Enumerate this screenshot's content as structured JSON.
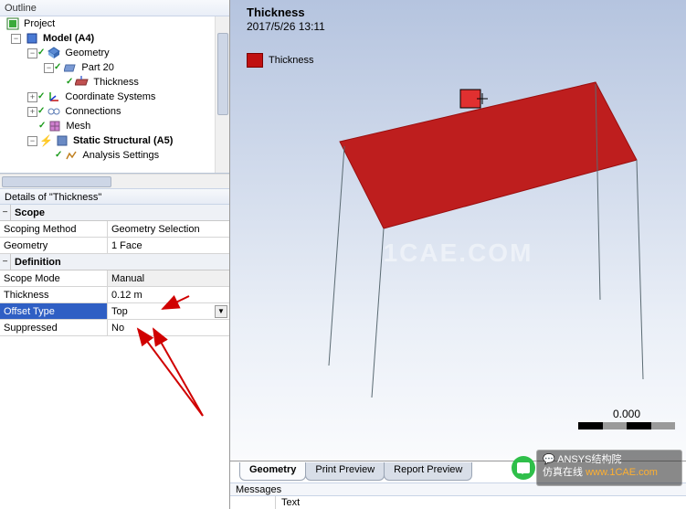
{
  "outline": {
    "title": "Outline",
    "nodes": {
      "project": "Project",
      "model": "Model (A4)",
      "geometry": "Geometry",
      "part": "Part 20",
      "thickness": "Thickness",
      "coord": "Coordinate Systems",
      "connections": "Connections",
      "mesh": "Mesh",
      "static": "Static Structural (A5)",
      "analysis": "Analysis Settings"
    }
  },
  "details": {
    "title": "Details of \"Thickness\"",
    "groups": {
      "scope": "Scope",
      "definition": "Definition"
    },
    "rows": {
      "scoping_method": {
        "label": "Scoping Method",
        "value": "Geometry Selection"
      },
      "geometry": {
        "label": "Geometry",
        "value": "1 Face"
      },
      "scope_mode": {
        "label": "Scope Mode",
        "value": "Manual"
      },
      "thickness": {
        "label": "Thickness",
        "value": "0.12 m"
      },
      "offset_type": {
        "label": "Offset Type",
        "value": "Top"
      },
      "suppressed": {
        "label": "Suppressed",
        "value": "No"
      }
    }
  },
  "viewport": {
    "title": "Thickness",
    "timestamp": "2017/5/26 13:11",
    "legend": "Thickness",
    "scale_value": "0.000",
    "watermark": "1CAE.COM"
  },
  "tabs": {
    "geometry": "Geometry",
    "print": "Print Preview",
    "report": "Report Preview"
  },
  "messages": {
    "title": "Messages",
    "col_text": "Text"
  },
  "banner": {
    "line1": "ANSYS结构院",
    "line2": "仿真在线",
    "url": "www.1CAE.com"
  }
}
